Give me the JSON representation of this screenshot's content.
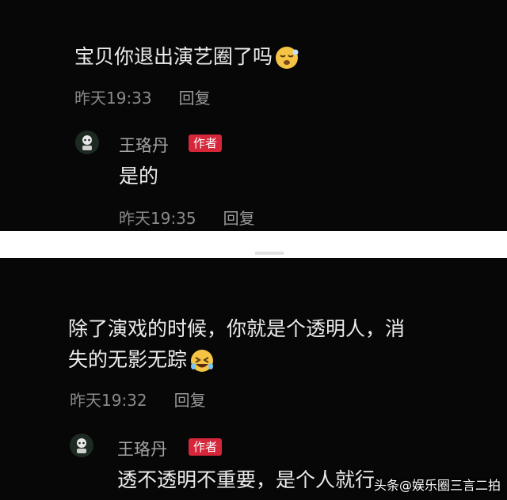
{
  "top": {
    "comment": {
      "text": "宝贝你退出演艺圈了吗",
      "emoji": "sleepy-face-emoji",
      "time": "昨天19:33",
      "reply_label": "回复"
    },
    "reply": {
      "author": "王珞丹",
      "badge": "作者",
      "text": "是的",
      "time": "昨天19:35",
      "reply_label": "回复"
    }
  },
  "bottom": {
    "comment": {
      "line1": "除了演戏的时候，你就是个透明人，消",
      "line2": "失的无影无踪",
      "emoji": "rolling-laughing-emoji",
      "time": "昨天19:32",
      "reply_label": "回复"
    },
    "reply": {
      "author": "王珞丹",
      "badge": "作者",
      "text": "透不透明不重要，是个人就行"
    }
  },
  "watermark": "头条@娱乐圈三言二拍",
  "colors": {
    "background": "#070707",
    "badge": "#d6263a",
    "text": "#ececec",
    "meta": "#8a8a8a"
  }
}
